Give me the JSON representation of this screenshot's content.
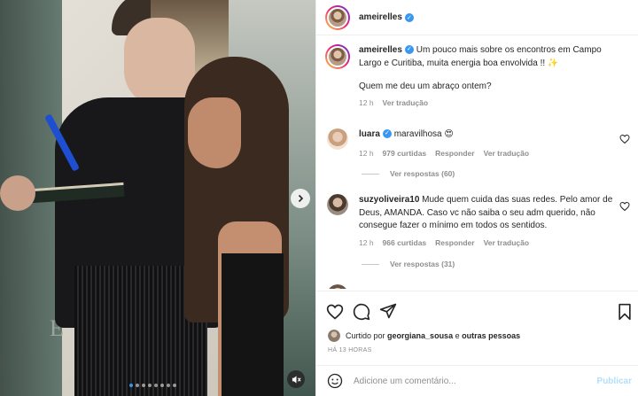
{
  "post": {
    "author": "ameirelles",
    "verified": true
  },
  "caption": {
    "username": "ameirelles",
    "text": "Um pouco mais sobre os encontros em Campo Largo e Curitiba, muita energia boa envolvida !! ✨",
    "text2": "Quem me deu um abraço ontem?",
    "time": "12 h",
    "translate": "Ver tradução"
  },
  "comments": [
    {
      "username": "luara",
      "verified": true,
      "text": "maravilhosa 😍",
      "time": "12 h",
      "likes": "979 curtidas",
      "reply": "Responder",
      "translate": "Ver tradução",
      "view_replies": "Ver respostas (60)"
    },
    {
      "username": "suzyoliveira10",
      "verified": false,
      "text": "Mude quem cuida das suas redes. Pelo amor de Deus, AMANDA. Caso vc não saiba o seu adm querido, não consegue fazer o mínimo em todos os sentidos.",
      "time": "12 h",
      "likes": "966 curtidas",
      "reply": "Responder",
      "translate": "Ver tradução",
      "view_replies": "Ver respostas (31)"
    }
  ],
  "liked_by": {
    "prefix": "Curtido por",
    "user": "georgiana_sousa",
    "connector": "e",
    "others": "outras pessoas"
  },
  "timestamp": "HÁ 13 HORAS",
  "add_comment": {
    "placeholder": "Adicione um comentário...",
    "publish": "Publicar"
  },
  "media": {
    "dots_total": 8,
    "dots_active": 1,
    "icons": [
      "chevron-right-icon",
      "mute-icon"
    ]
  },
  "colors": {
    "accent": "#3897f0",
    "publish_disabled": "#b2dffc",
    "muted_text": "#8e8e8e"
  }
}
